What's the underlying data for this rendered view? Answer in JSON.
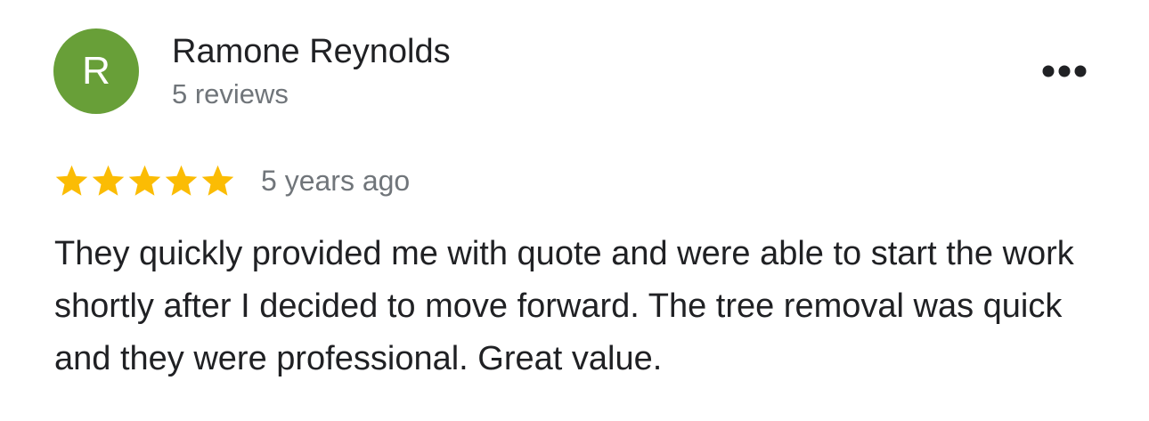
{
  "review": {
    "author": {
      "name": "Ramone Reynolds",
      "initial": "R",
      "meta": "5 reviews",
      "avatar_color": "#689f38"
    },
    "rating": {
      "stars": 5,
      "max": 5,
      "star_color": "#fbbc04",
      "icon": "star-icon"
    },
    "date": "5 years ago",
    "text": "They quickly provided me with quote and were able to start the work shortly after I decided to move forward. The tree removal was quick and they were professional. Great value.",
    "menu_icon": "more-horiz-icon"
  }
}
